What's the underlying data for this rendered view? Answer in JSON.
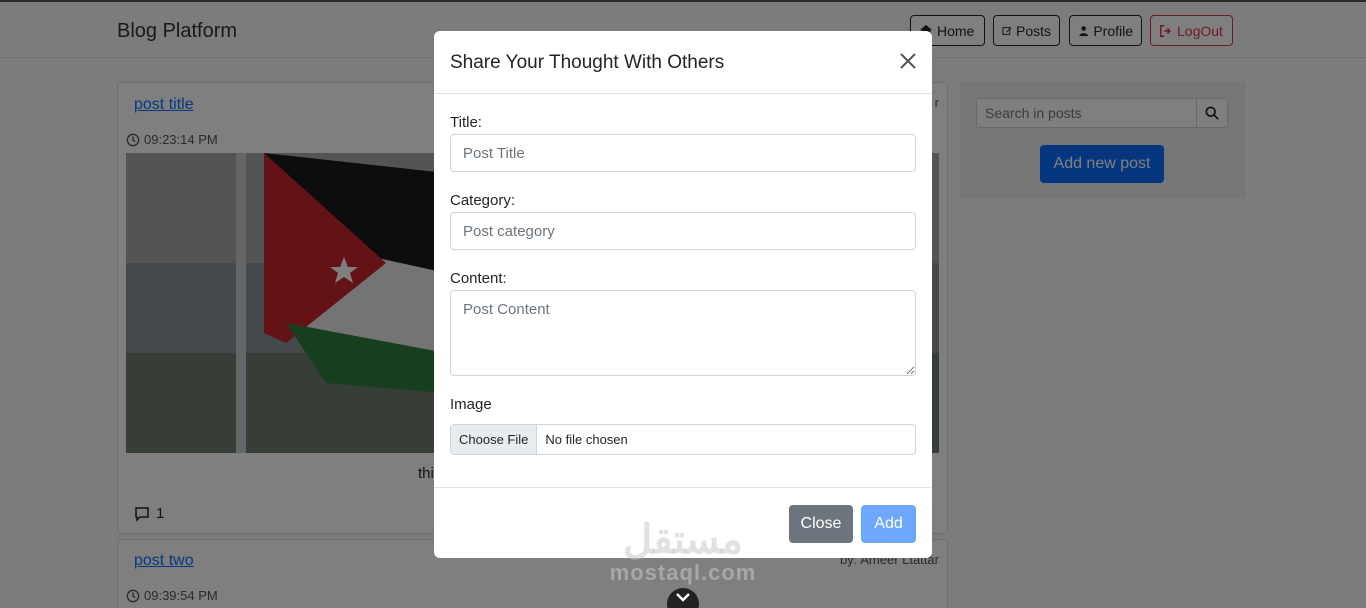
{
  "navbar": {
    "brand": "Blog Platform",
    "buttons": [
      {
        "label": "Home",
        "icon": "home-icon"
      },
      {
        "label": "Posts",
        "icon": "edit-icon"
      },
      {
        "label": "Profile",
        "icon": "user-icon"
      },
      {
        "label": "LogOut",
        "icon": "logout-icon"
      }
    ]
  },
  "posts": [
    {
      "title": "post title",
      "time": "09:23:14 PM",
      "author": "r",
      "text": "thi",
      "comments": "1"
    },
    {
      "title": "post two",
      "time": "09:39:54 PM",
      "author": "by: Ameer Ltattar"
    }
  ],
  "sidebar": {
    "search_placeholder": "Search in posts",
    "add_button": "Add new post"
  },
  "modal": {
    "title": "Share Your Thought With Others",
    "fields": {
      "title_label": "Title:",
      "title_placeholder": "Post Title",
      "category_label": "Category:",
      "category_placeholder": "Post category",
      "content_label": "Content:",
      "content_placeholder": "Post Content",
      "image_label": "Image",
      "file_button": "Choose File",
      "file_status": "No file chosen"
    },
    "footer": {
      "close": "Close",
      "add": "Add"
    }
  },
  "watermark": {
    "arabic": "مستقل",
    "latin": "mostaql.com"
  },
  "colors": {
    "primary": "#0d6efd",
    "secondary": "#6c757d",
    "danger": "#dc3545",
    "add_disabled": "#6ea8fe"
  }
}
